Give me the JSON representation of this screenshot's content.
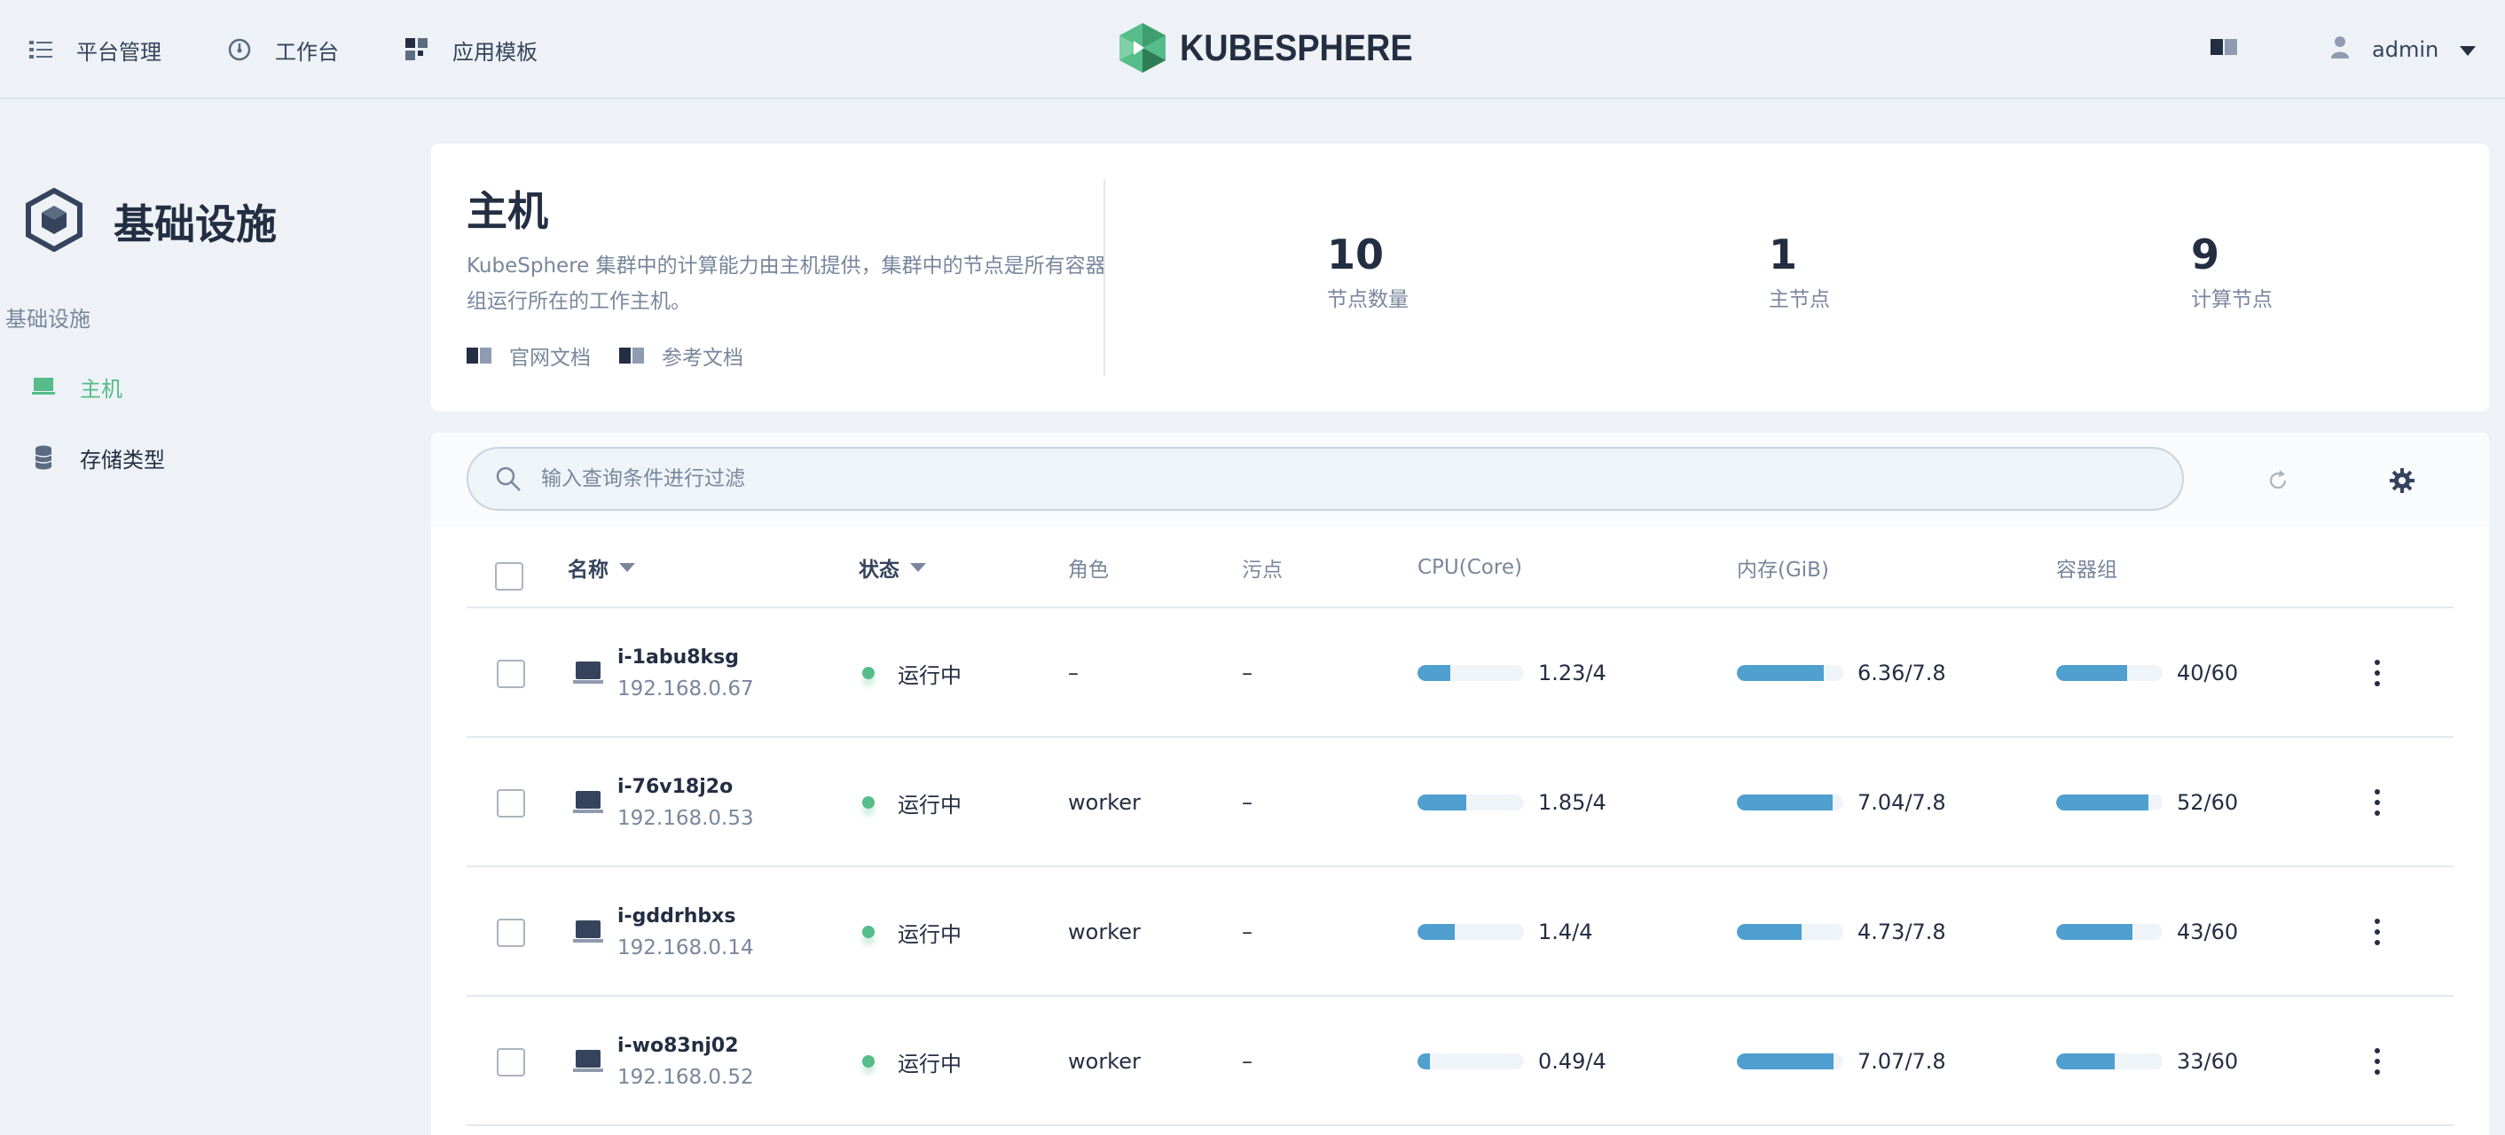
{
  "nav": {
    "items": [
      {
        "label": "平台管理",
        "icon": "list-icon"
      },
      {
        "label": "工作台",
        "icon": "dashboard-icon"
      },
      {
        "label": "应用模板",
        "icon": "apps-icon"
      }
    ],
    "logo_text": "KUBESPHERE",
    "user": "admin"
  },
  "sidebar": {
    "title": "基础设施",
    "group": "基础设施",
    "items": [
      {
        "label": "主机",
        "icon": "host-icon",
        "active": true
      },
      {
        "label": "存储类型",
        "icon": "database-icon",
        "active": false
      }
    ]
  },
  "banner": {
    "title": "主机",
    "description": "KubeSphere 集群中的计算能力由主机提供，集群中的节点是所有容器组运行所在的工作主机。",
    "links": [
      "官网文档",
      "参考文档"
    ],
    "stats": [
      {
        "value": "10",
        "label": "节点数量"
      },
      {
        "value": "1",
        "label": "主节点"
      },
      {
        "value": "9",
        "label": "计算节点"
      }
    ]
  },
  "search": {
    "placeholder": "输入查询条件进行过滤"
  },
  "table": {
    "headers": {
      "name": "名称",
      "status": "状态",
      "role": "角色",
      "taints": "污点",
      "cpu": "CPU(Core)",
      "memory": "内存(GiB)",
      "pods": "容器组"
    },
    "rows": [
      {
        "name": "i-1abu8ksg",
        "ip": "192.168.0.67",
        "status": "运行中",
        "role": "–",
        "taints": "–",
        "cpu": "1.23/4",
        "cpu_ratio": 0.31,
        "memory": "6.36/7.8",
        "memory_ratio": 0.82,
        "pods": "40/60",
        "pods_ratio": 0.67
      },
      {
        "name": "i-76v18j2o",
        "ip": "192.168.0.53",
        "status": "运行中",
        "role": "worker",
        "taints": "–",
        "cpu": "1.85/4",
        "cpu_ratio": 0.46,
        "memory": "7.04/7.8",
        "memory_ratio": 0.9,
        "pods": "52/60",
        "pods_ratio": 0.87
      },
      {
        "name": "i-gddrhbxs",
        "ip": "192.168.0.14",
        "status": "运行中",
        "role": "worker",
        "taints": "–",
        "cpu": "1.4/4",
        "cpu_ratio": 0.35,
        "memory": "4.73/7.8",
        "memory_ratio": 0.61,
        "pods": "43/60",
        "pods_ratio": 0.72
      },
      {
        "name": "i-wo83nj02",
        "ip": "192.168.0.52",
        "status": "运行中",
        "role": "worker",
        "taints": "–",
        "cpu": "0.49/4",
        "cpu_ratio": 0.12,
        "memory": "7.07/7.8",
        "memory_ratio": 0.91,
        "pods": "33/60",
        "pods_ratio": 0.55
      }
    ]
  },
  "colors": {
    "accent_green": "#55bc8a",
    "bar_blue": "#4f9fcf",
    "text_dark": "#242e42",
    "text_muted": "#79879c",
    "background": "#eef2f6"
  }
}
